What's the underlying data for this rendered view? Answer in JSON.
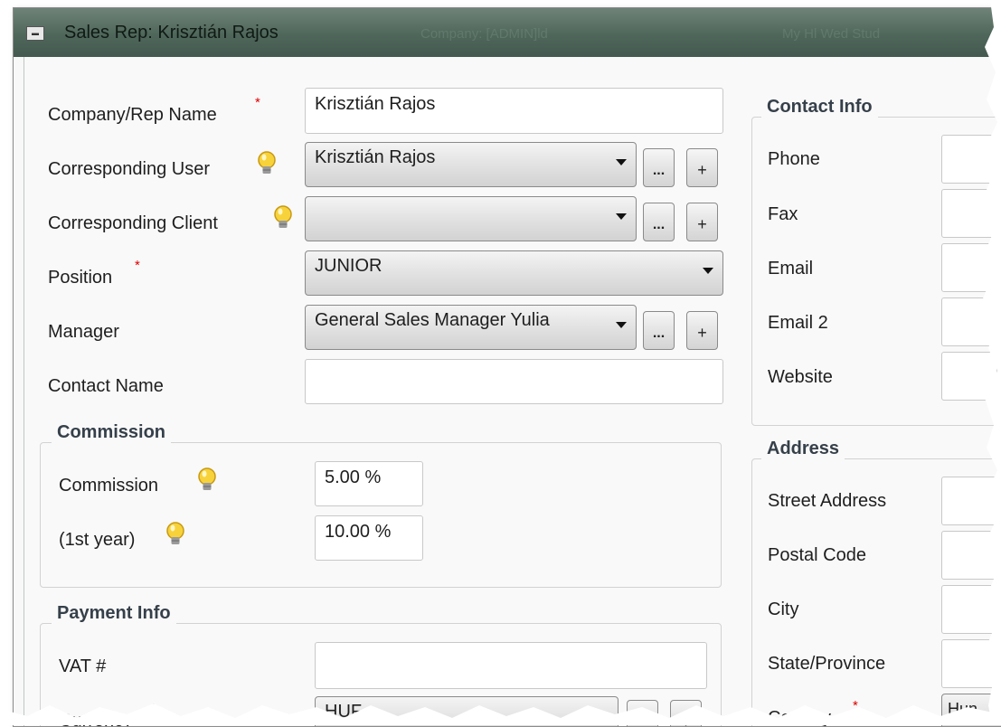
{
  "window": {
    "title": "Sales Rep: Krisztián Rajos",
    "icon": "window-app-icon",
    "background_ghost_titles": [
      "Company: [ADMIN]ld",
      "My Hl Wed Stud"
    ]
  },
  "form": {
    "company_rep_name": {
      "label": "Company/Rep Name",
      "value": "Krisztián Rajos",
      "required": "*"
    },
    "corresponding_user": {
      "label": "Corresponding User",
      "value": "Krisztián Rajos",
      "more": "...",
      "add": "+"
    },
    "corresponding_client": {
      "label": "Corresponding Client",
      "value": "",
      "more": "...",
      "add": "+"
    },
    "position": {
      "label": "Position",
      "value": "JUNIOR",
      "required": "*"
    },
    "manager": {
      "label": "Manager",
      "value": "General Sales Manager Yulia",
      "more": "...",
      "add": "+"
    },
    "contact_name": {
      "label": "Contact Name",
      "value": ""
    }
  },
  "commission": {
    "title": "Commission",
    "commission": {
      "label": "Commission",
      "value": "5.00 %"
    },
    "first_year": {
      "label": "(1st year)",
      "value": "10.00 %"
    }
  },
  "payment": {
    "title": "Payment Info",
    "vat": {
      "label": "VAT #",
      "value": ""
    },
    "currency": {
      "label": "Currency",
      "value": "HUF",
      "required": "*"
    }
  },
  "contact_info": {
    "title": "Contact Info",
    "fields": [
      {
        "label": "Phone"
      },
      {
        "label": "Fax"
      },
      {
        "label": "Email"
      },
      {
        "label": "Email 2"
      },
      {
        "label": "Website"
      }
    ]
  },
  "address": {
    "title": "Address",
    "fields": [
      {
        "label": "Street Address"
      },
      {
        "label": "Postal Code"
      },
      {
        "label": "City"
      },
      {
        "label": "State/Province"
      },
      {
        "label": "Country",
        "required": "*",
        "value": "Hun"
      }
    ]
  },
  "colors": {
    "required": "#e00000",
    "title_bar": "#4f665b",
    "group_title": "#36404a"
  }
}
